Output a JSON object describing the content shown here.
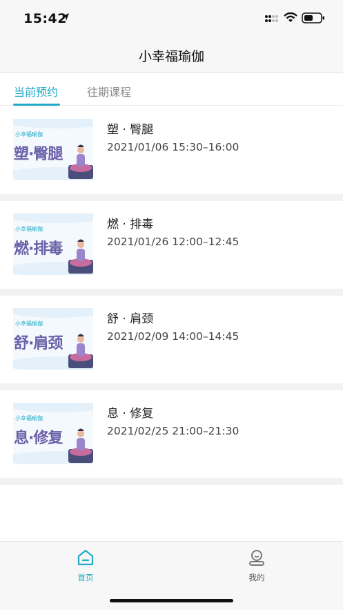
{
  "status_bar": {
    "time": "15:42"
  },
  "nav": {
    "title": "小幸福瑜伽"
  },
  "tabs": [
    {
      "label": "当前预约",
      "active": true
    },
    {
      "label": "往期课程",
      "active": false
    }
  ],
  "thumb_brand": "小幸福瑜伽",
  "courses": [
    {
      "title": "塑 · 臀腿",
      "thumb_text": "塑·臀腿",
      "time": "2021/01/06 15:30–16:00"
    },
    {
      "title": "燃 · 排毒",
      "thumb_text": "燃·排毒",
      "time": "2021/01/26 12:00–12:45"
    },
    {
      "title": "舒 · 肩颈",
      "thumb_text": "舒·肩颈",
      "time": "2021/02/09 14:00–14:45"
    },
    {
      "title": "息 · 修复",
      "thumb_text": "息·修复",
      "time": "2021/02/25 21:00–21:30"
    }
  ],
  "tabbar": [
    {
      "label": "首页",
      "icon": "home-icon",
      "active": true
    },
    {
      "label": "我的",
      "icon": "profile-icon",
      "active": false
    }
  ],
  "colors": {
    "accent": "#1fa9c7",
    "thumb_text": "#6c5fa8"
  }
}
